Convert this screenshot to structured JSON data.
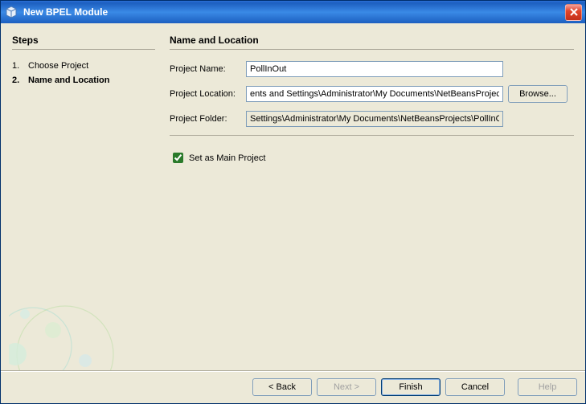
{
  "window": {
    "title": "New BPEL Module",
    "close_icon": "close-icon"
  },
  "steps": {
    "heading": "Steps",
    "items": [
      {
        "num": "1.",
        "label": "Choose Project",
        "current": false
      },
      {
        "num": "2.",
        "label": "Name and Location",
        "current": true
      }
    ]
  },
  "main": {
    "heading": "Name and Location",
    "project_name_label": "Project Name:",
    "project_name_value": "PollInOut",
    "project_location_label": "Project Location:",
    "project_location_value": "ents and Settings\\Administrator\\My Documents\\NetBeansProjects",
    "browse_label": "Browse...",
    "project_folder_label": "Project Folder:",
    "project_folder_value": "Settings\\Administrator\\My Documents\\NetBeansProjects\\PollInOut",
    "set_main_label": "Set as Main Project",
    "set_main_checked": true
  },
  "buttons": {
    "back": "< Back",
    "next": "Next >",
    "finish": "Finish",
    "cancel": "Cancel",
    "help": "Help"
  }
}
